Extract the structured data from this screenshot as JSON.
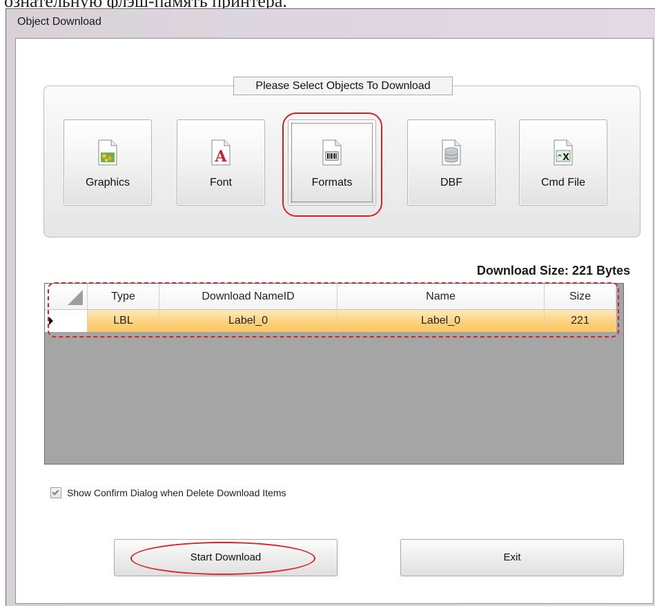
{
  "page_top_text": "ознательную флэш-память принтера.",
  "window": {
    "title": "Object Download"
  },
  "select_group": {
    "title": "Please Select Objects To Download",
    "buttons": [
      {
        "label": "Graphics",
        "icon": "graphics-icon"
      },
      {
        "label": "Font",
        "icon": "font-icon"
      },
      {
        "label": "Formats",
        "icon": "barcode-format-icon",
        "focused": true
      },
      {
        "label": "DBF",
        "icon": "database-icon"
      },
      {
        "label": "Cmd File",
        "icon": "command-file-icon"
      }
    ]
  },
  "download_size": "Download Size: 221 Bytes",
  "table": {
    "columns": [
      "Type",
      "Download NameID",
      "Name",
      "Size"
    ],
    "rows": [
      {
        "type": "LBL",
        "download_name_id": "Label_0",
        "name": "Label_0",
        "size": "221"
      }
    ]
  },
  "confirm_checkbox": {
    "label": "Show Confirm Dialog when Delete Download Items",
    "checked": true
  },
  "actions": {
    "start_label": "Start Download",
    "exit_label": "Exit"
  },
  "annotation_color": "#d81f26",
  "selection_color": "#fdd27f"
}
